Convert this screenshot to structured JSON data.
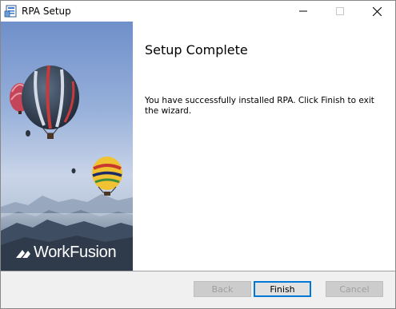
{
  "window": {
    "title": "RPA Setup",
    "app_icon": "installer-icon",
    "controls": {
      "minimize": "minimize-icon",
      "maximize": "maximize-icon",
      "close": "close-icon"
    }
  },
  "banner": {
    "brand_name": "WorkFusion",
    "image": "hot-air-balloons-over-mountains"
  },
  "content": {
    "heading": "Setup Complete",
    "message": "You have successfully installed RPA. Click Finish to exit the wizard."
  },
  "buttons": {
    "back": {
      "label": "Back",
      "enabled": false
    },
    "finish": {
      "label": "Finish",
      "enabled": true,
      "default": true
    },
    "cancel": {
      "label": "Cancel",
      "enabled": false
    }
  },
  "colors": {
    "accent": "#0078d7",
    "bottom_bar": "#f0f0f0",
    "disabled_text": "#a0a0a0"
  }
}
